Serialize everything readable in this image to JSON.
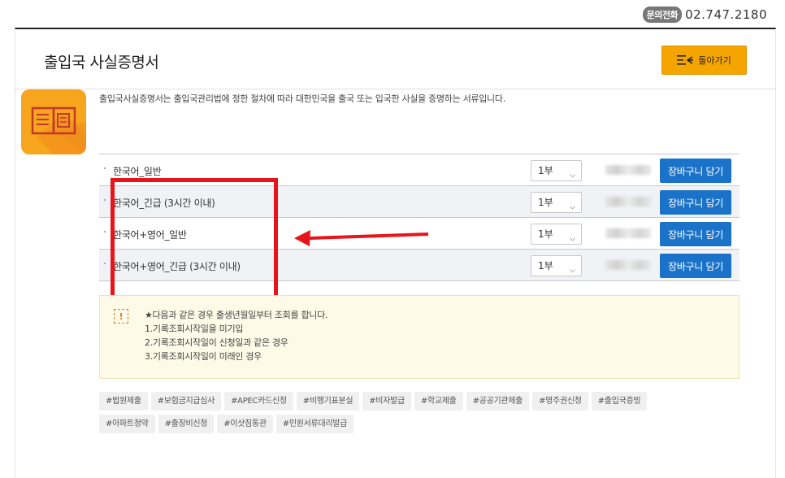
{
  "contact": {
    "badge": "문의전화",
    "phone": "02.747.2180"
  },
  "header": {
    "title": "출입국 사실증명서",
    "back_label": "돌아가기"
  },
  "description": "출입국사실증명서는 출입국관리법에 정한 절차에 따라 대한민국을 출국 또는 입국한 사실을 증명하는 서류입니다.",
  "options": [
    {
      "label": "한국어_일반",
      "quantity": "1부",
      "cart_label": "장바구니 담기"
    },
    {
      "label": "한국어_긴급 (3시간 이내)",
      "quantity": "1부",
      "cart_label": "장바구니 담기"
    },
    {
      "label": "한국어+영어_일반",
      "quantity": "1부",
      "cart_label": "장바구니 담기"
    },
    {
      "label": "한국어+영어_긴급 (3시간 이내)",
      "quantity": "1부",
      "cart_label": "장바구니 담기"
    }
  ],
  "notice": {
    "icon": "!",
    "lines": [
      "★다음과 같은 경우 출생년월일부터 조회를 합니다.",
      "1.기록조회시작일을 미기입",
      "2.기록조회시작일이 신청일과 같은 경우",
      "3.기록조회시작일이 미래인 경우"
    ]
  },
  "tags": [
    "#법원제출",
    "#보험금지급심사",
    "#APEC카드신청",
    "#비행기표분실",
    "#비자발급",
    "#학교제출",
    "#공공기관제출",
    "#영주권신청",
    "#출입국증빙",
    "#아파트청약",
    "#출장비신청",
    "#이삿짐통관",
    "#민원서류대리발급"
  ],
  "colors": {
    "accent_orange": "#f5a500",
    "cart_blue": "#1a73c8",
    "highlight_red": "#e8141b"
  }
}
